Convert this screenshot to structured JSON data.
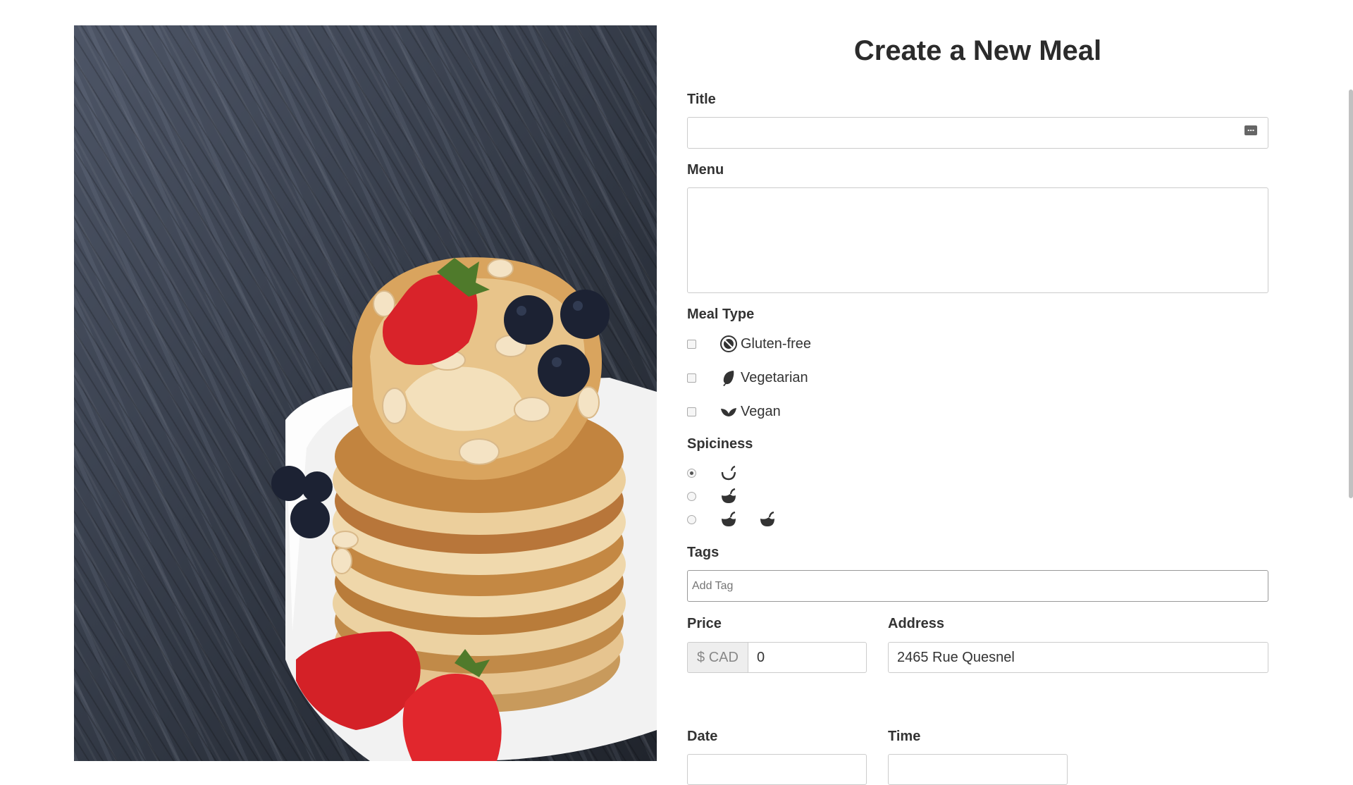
{
  "page": {
    "title": "Create a New Meal"
  },
  "photo": {
    "alt": ""
  },
  "form": {
    "title_label": "Title",
    "title_value": "",
    "menu_label": "Menu",
    "menu_value": "",
    "meal_type_label": "Meal Type",
    "meal_types": [
      {
        "label": "Gluten-free",
        "icon": "gluten-free-icon",
        "checked": false
      },
      {
        "label": "Vegetarian",
        "icon": "leaf-icon",
        "checked": false
      },
      {
        "label": "Vegan",
        "icon": "sprout-icon",
        "checked": false
      }
    ],
    "spiciness_label": "Spiciness",
    "spiciness_options": [
      {
        "level": 1,
        "icons": [
          "pepper-outline-icon"
        ],
        "selected": true
      },
      {
        "level": 2,
        "icons": [
          "pepper-icon"
        ],
        "selected": false
      },
      {
        "level": 3,
        "icons": [
          "pepper-icon",
          "pepper-icon"
        ],
        "selected": false
      }
    ],
    "tags_label": "Tags",
    "tags_placeholder": "Add Tag",
    "price_label": "Price",
    "price_addon": "$ CAD",
    "price_value": "0",
    "address_label": "Address",
    "address_value": "2465 Rue Quesnel",
    "date_label": "Date",
    "time_label": "Time"
  },
  "colors": {
    "accent_text": "#333333",
    "input_border": "#cccccc",
    "addon_bg": "#eeeeee"
  }
}
